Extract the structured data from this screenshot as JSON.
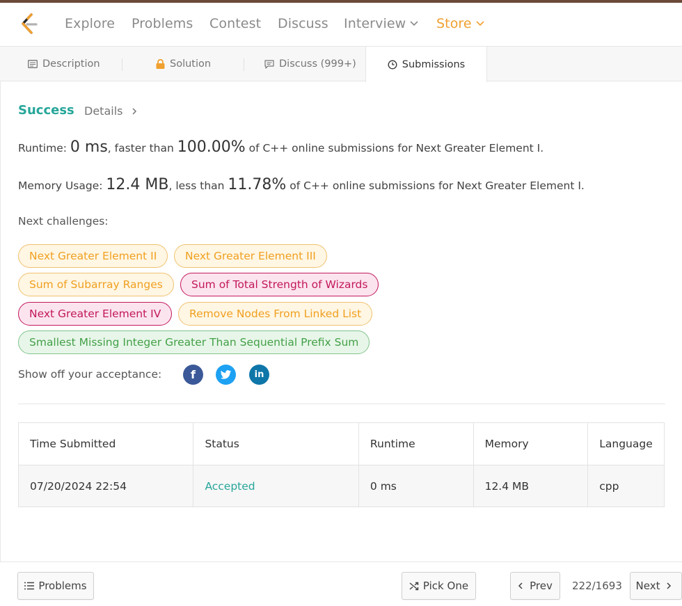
{
  "nav": {
    "items": [
      "Explore",
      "Problems",
      "Contest",
      "Discuss",
      "Interview",
      "Store"
    ],
    "accent": "#f0a030"
  },
  "tabs": [
    "Description",
    "Solution",
    "Discuss (999+)",
    "Submissions"
  ],
  "result": {
    "status": "Success",
    "details": "Details",
    "runtime_label": "Runtime:",
    "runtime_value": "0 ms",
    "runtime_mid": ", faster than",
    "runtime_pct": "100.00%",
    "runtime_tail": "of C++ online submissions for Next Greater Element I.",
    "memory_label": "Memory Usage:",
    "memory_value": "12.4 MB",
    "memory_mid": ", less than",
    "memory_pct": "11.78%",
    "memory_tail": "of C++ online submissions for Next Greater Element I."
  },
  "challenges": {
    "label": "Next challenges:",
    "items": [
      {
        "title": "Next Greater Element II",
        "difficulty": "medium"
      },
      {
        "title": "Next Greater Element III",
        "difficulty": "medium"
      },
      {
        "title": "Sum of Subarray Ranges",
        "difficulty": "medium"
      },
      {
        "title": "Sum of Total Strength of Wizards",
        "difficulty": "hard"
      },
      {
        "title": "Next Greater Element IV",
        "difficulty": "hard"
      },
      {
        "title": "Remove Nodes From Linked List",
        "difficulty": "medium"
      },
      {
        "title": "Smallest Missing Integer Greater Than Sequential Prefix Sum",
        "difficulty": "easy"
      }
    ]
  },
  "share": {
    "label": "Show off your acceptance:",
    "icons": [
      "facebook-icon",
      "twitter-icon",
      "linkedin-icon"
    ]
  },
  "submissions": {
    "columns": [
      "Time Submitted",
      "Status",
      "Runtime",
      "Memory",
      "Language"
    ],
    "rows": [
      [
        "07/20/2024 22:54",
        "Accepted",
        "0 ms",
        "12.4 MB",
        "cpp"
      ]
    ]
  },
  "footer": {
    "problems": "Problems",
    "pick_one": "Pick One",
    "prev": "Prev",
    "counter": "222/1693",
    "next": "Next"
  }
}
